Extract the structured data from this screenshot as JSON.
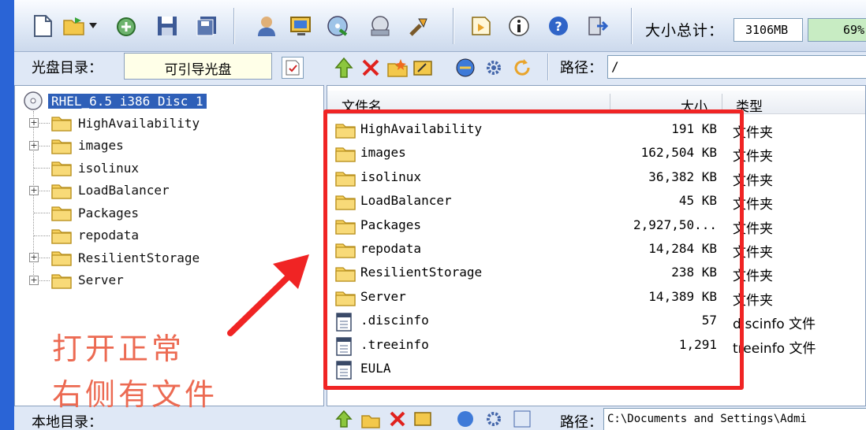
{
  "toolbar": {
    "size_total_label": "大小总计：",
    "size_total_value": "3106MB",
    "usage_percent": "69%"
  },
  "disc_panel": {
    "label": "光盘目录：",
    "disc_type": "可引导光盘",
    "tree_root": "RHEL_6.5 i386 Disc 1",
    "tree_items": [
      {
        "name": "HighAvailability",
        "expandable": true
      },
      {
        "name": "images",
        "expandable": true
      },
      {
        "name": "isolinux",
        "expandable": false
      },
      {
        "name": "LoadBalancer",
        "expandable": true
      },
      {
        "name": "Packages",
        "expandable": false
      },
      {
        "name": "repodata",
        "expandable": false
      },
      {
        "name": "ResilientStorage",
        "expandable": true
      },
      {
        "name": "Server",
        "expandable": true
      }
    ]
  },
  "file_panel": {
    "path_label": "路径：",
    "path_value": "/",
    "columns": {
      "name": "文件名",
      "size": "大小",
      "type": "类型"
    },
    "files": [
      {
        "name": "HighAvailability",
        "size": "191 KB",
        "type": "文件夹",
        "kind": "folder"
      },
      {
        "name": "images",
        "size": "162,504 KB",
        "type": "文件夹",
        "kind": "folder"
      },
      {
        "name": "isolinux",
        "size": "36,382 KB",
        "type": "文件夹",
        "kind": "folder"
      },
      {
        "name": "LoadBalancer",
        "size": "45 KB",
        "type": "文件夹",
        "kind": "folder"
      },
      {
        "name": "Packages",
        "size": "2,927,50...",
        "type": "文件夹",
        "kind": "folder"
      },
      {
        "name": "repodata",
        "size": "14,284 KB",
        "type": "文件夹",
        "kind": "folder"
      },
      {
        "name": "ResilientStorage",
        "size": "238 KB",
        "type": "文件夹",
        "kind": "folder"
      },
      {
        "name": "Server",
        "size": "14,389 KB",
        "type": "文件夹",
        "kind": "folder"
      },
      {
        "name": ".discinfo",
        "size": "57",
        "type": "discinfo 文件",
        "kind": "file"
      },
      {
        "name": ".treeinfo",
        "size": "1,291",
        "type": "treeinfo 文件",
        "kind": "file"
      },
      {
        "name": "EULA",
        "size": "",
        "type": "",
        "kind": "file"
      }
    ]
  },
  "local_panel": {
    "label": "本地目录：",
    "path_label": "路径：",
    "path_value": "C:\\Documents and Settings\\Admi"
  },
  "annotation": {
    "line1": "打开正常",
    "line2": "右侧有文件",
    "color": "#ec6a52",
    "box_color": "#f02424"
  }
}
